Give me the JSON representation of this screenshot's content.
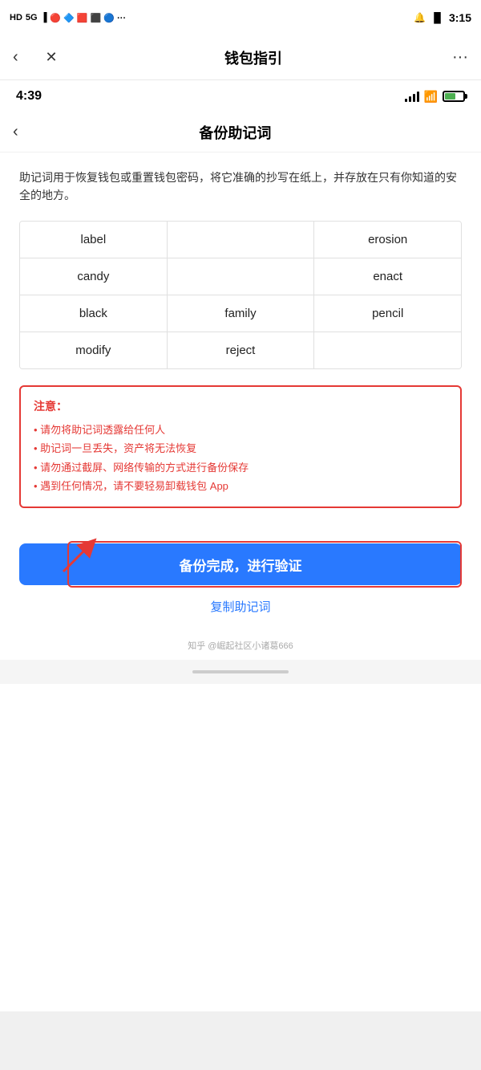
{
  "outerStatusBar": {
    "leftIcons": "HD 5G..il 🔴🔷🔲⬛ 🔵...",
    "time": "3:15",
    "bellIcon": "🔔",
    "batteryLabel": ""
  },
  "topNav": {
    "backLabel": "‹",
    "closeLabel": "✕",
    "title": "钱包指引",
    "moreLabel": "···"
  },
  "innerStatusBar": {
    "time": "4:39"
  },
  "innerPageHeader": {
    "backLabel": "‹",
    "title": "备份助记词"
  },
  "description": "助记词用于恢复钱包或重置钱包密码，将它准确的抄写在纸上，并存放在只有你知道的安全的地方。",
  "mnemonicWords": [
    [
      "label",
      "",
      "erosion"
    ],
    [
      "candy",
      "",
      "enact"
    ],
    [
      "black",
      "family",
      "pencil"
    ],
    [
      "modify",
      "reject",
      ""
    ]
  ],
  "warningBox": {
    "title": "注意：",
    "items": [
      "• 请勿将助记词透露给任何人",
      "• 助记词一旦丢失，资产将无法恢复",
      "• 请勿通过截屏、网络传输的方式进行备份保存",
      "• 遇到任何情况，请不要轻易卸载钱包 App"
    ]
  },
  "primaryButton": {
    "label": "备份完成，进行验证"
  },
  "copyLink": {
    "label": "复制助记词"
  },
  "watermark": "知乎 @崛起社区小诸葛666"
}
